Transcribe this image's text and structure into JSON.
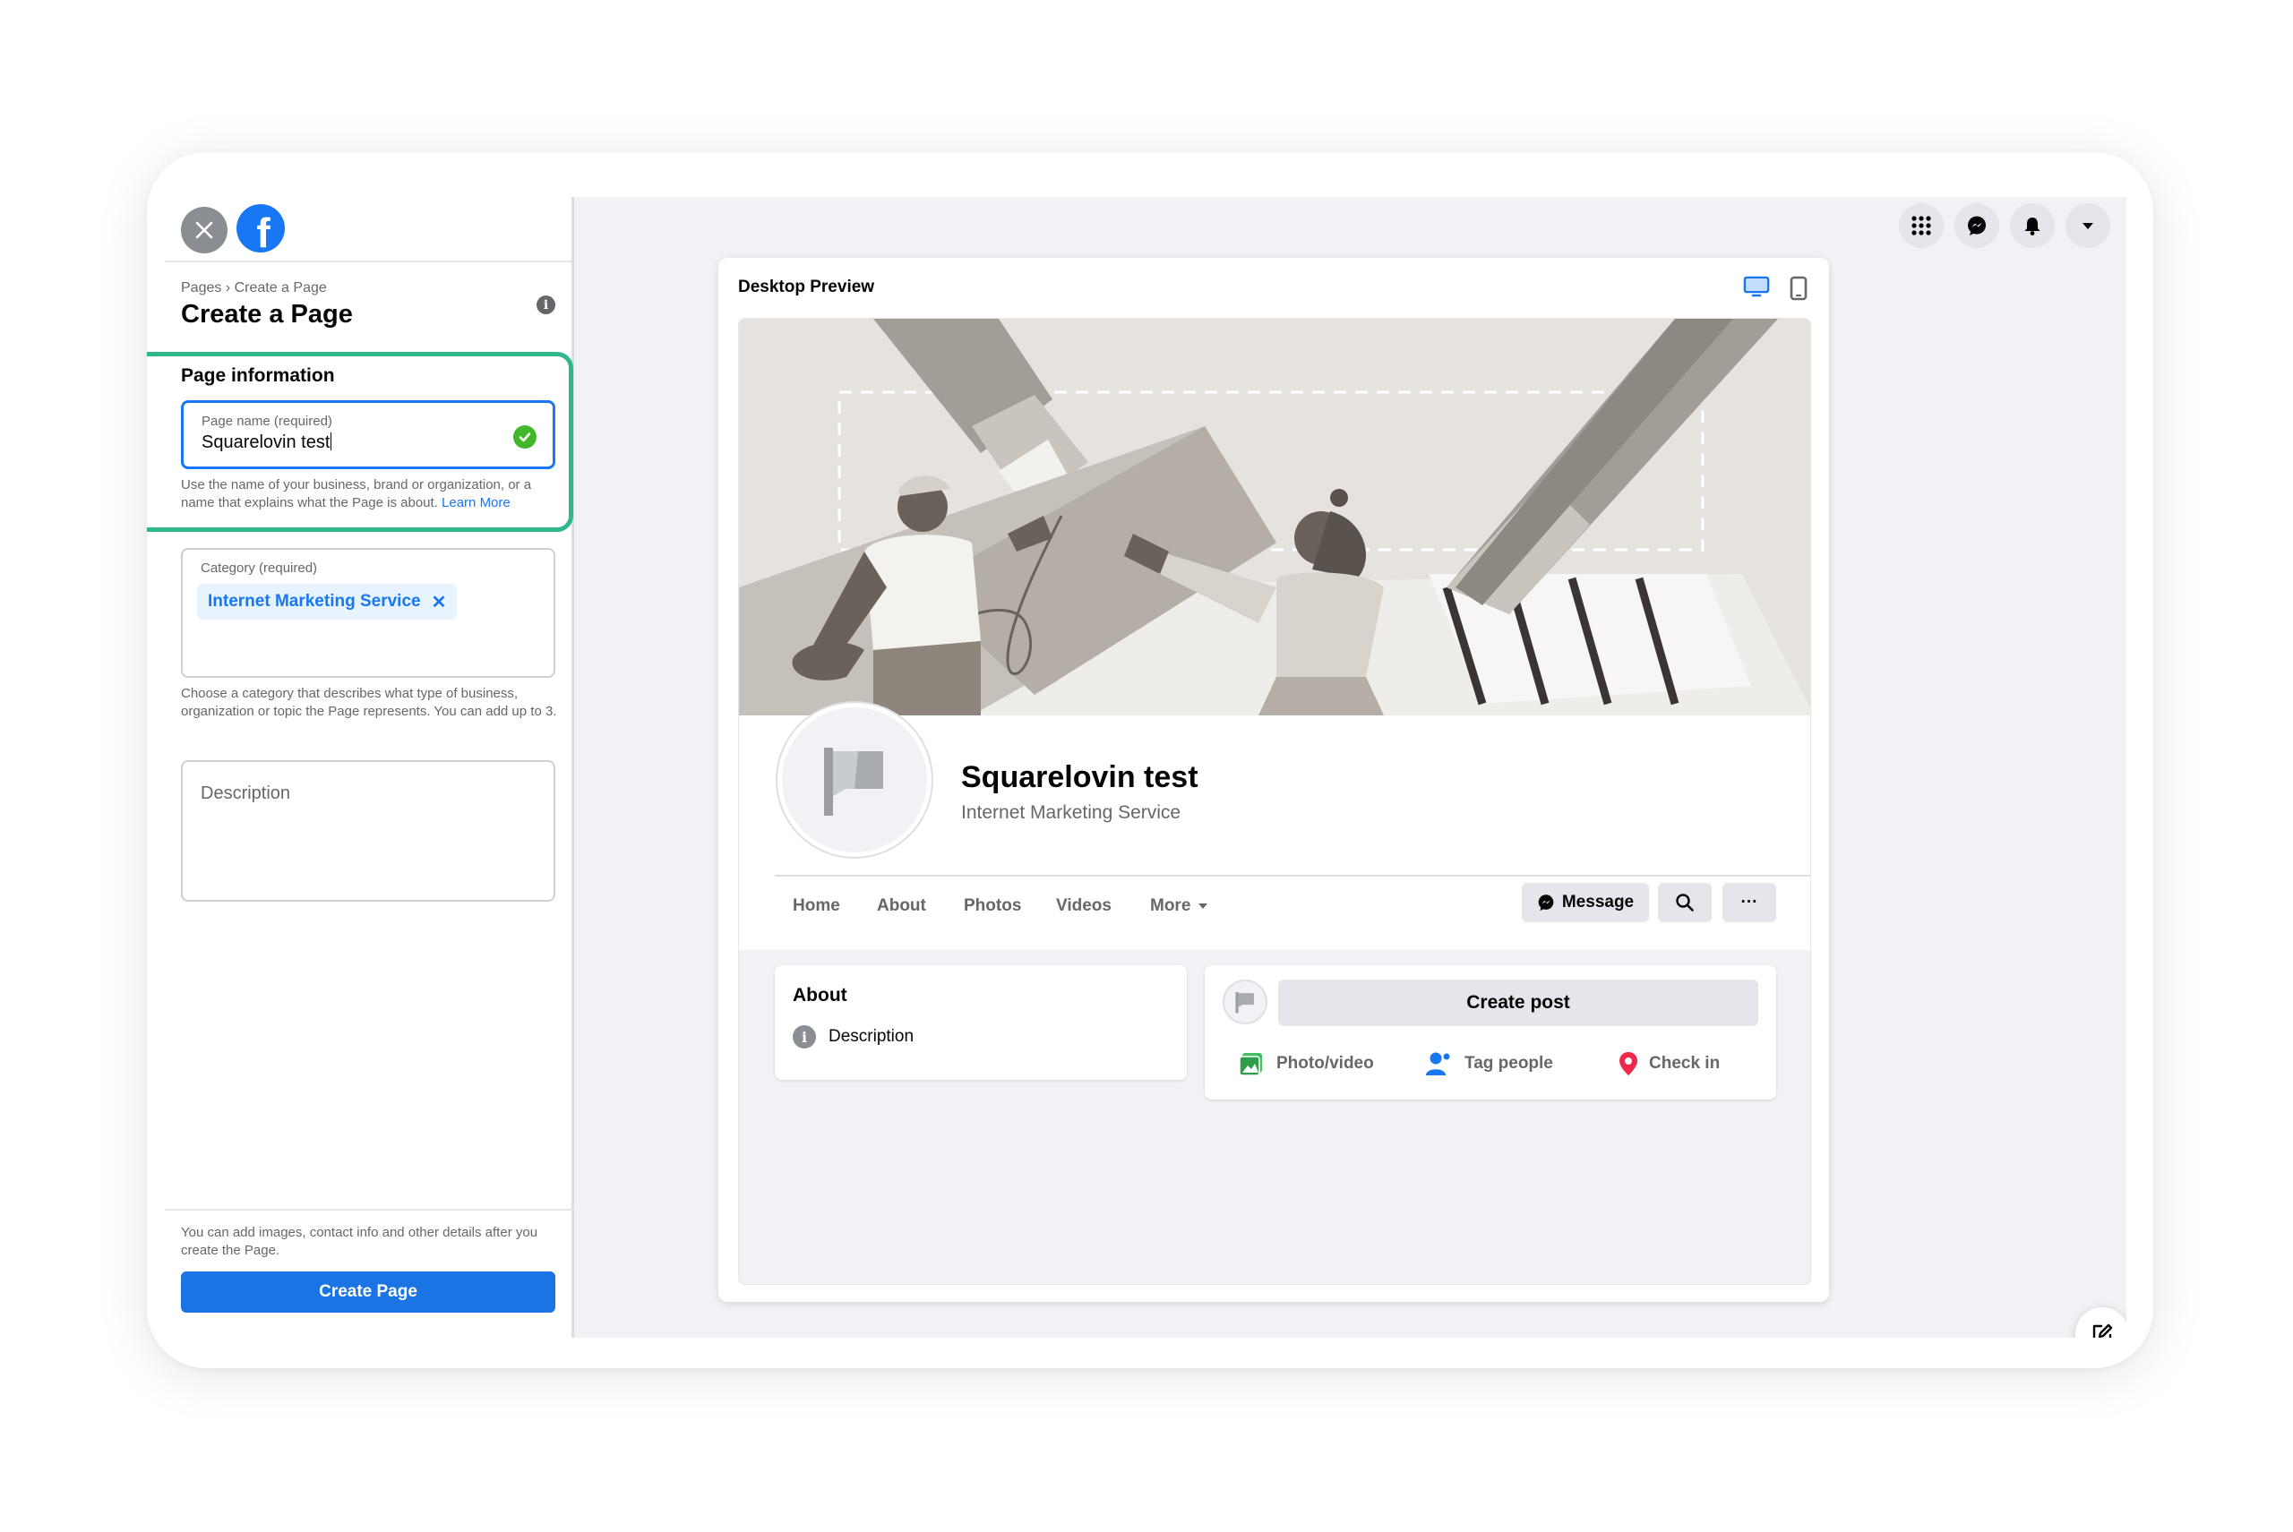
{
  "sidebar": {
    "breadcrumb": "Pages › Create a Page",
    "title": "Create a Page",
    "section_title": "Page information",
    "page_name": {
      "label": "Page name (required)",
      "value": "Squarelovin test"
    },
    "page_name_help": "Use the name of your business, brand or organization, or a name that explains what the Page is about.",
    "learn_more": "Learn More",
    "category": {
      "label": "Category (required)",
      "chip": "Internet Marketing Service"
    },
    "category_help": "Choose a category that describes what type of business, organization or topic the Page represents. You can add up to 3.",
    "description_placeholder": "Description",
    "footer_note": "You can add images, contact info and other details after you create the Page.",
    "create_button": "Create Page"
  },
  "preview": {
    "title": "Desktop Preview",
    "page_name": "Squarelovin test",
    "page_category": "Internet Marketing Service",
    "tabs": [
      "Home",
      "About",
      "Photos",
      "Videos",
      "More"
    ],
    "message_button": "Message",
    "more_button": "···",
    "about": {
      "title": "About",
      "description": "Description"
    },
    "create_post": "Create post",
    "actions": [
      "Photo/video",
      "Tag people",
      "Check in"
    ]
  },
  "colors": {
    "accent": "#1877f2",
    "highlight": "#2fb68b",
    "check": "#42b72a"
  },
  "icons": [
    "close-icon",
    "facebook-logo-icon",
    "info-icon",
    "check-icon",
    "menu-grid-icon",
    "messenger-icon",
    "bell-icon",
    "caret-down-icon",
    "desktop-icon",
    "mobile-icon",
    "flag-icon",
    "search-icon",
    "photo-icon",
    "tag-people-icon",
    "location-pin-icon",
    "edit-icon"
  ]
}
